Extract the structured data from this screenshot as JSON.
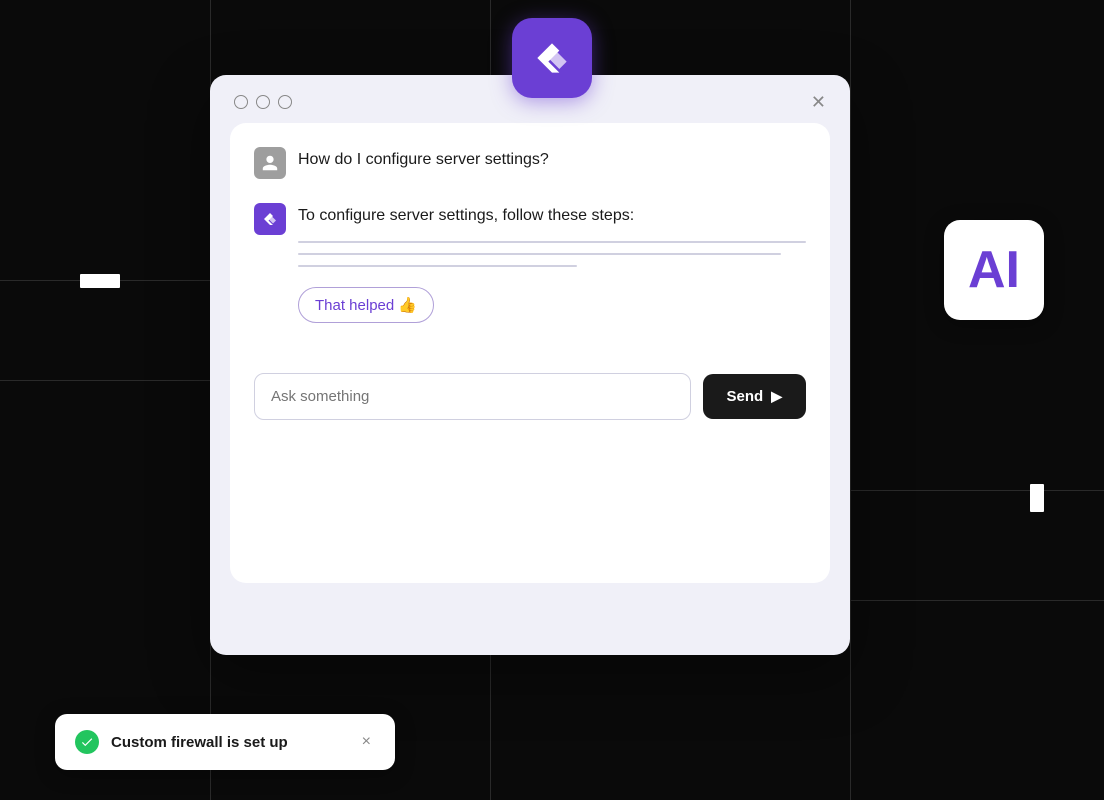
{
  "background": {
    "color": "#0a0a0a"
  },
  "logo_badge": {
    "aria_label": "App logo"
  },
  "app_window": {
    "window_controls_label": "Window controls",
    "close_label": "✕"
  },
  "chat": {
    "user_message": "How do I configure server settings?",
    "ai_intro": "To configure server settings, follow these steps:",
    "suggestion_label": "That helped 👍",
    "input_placeholder": "Ask something",
    "send_label": "Send"
  },
  "ai_badge": {
    "label": "AI"
  },
  "toast": {
    "message": "Custom firewall is set up",
    "close_label": "×"
  }
}
